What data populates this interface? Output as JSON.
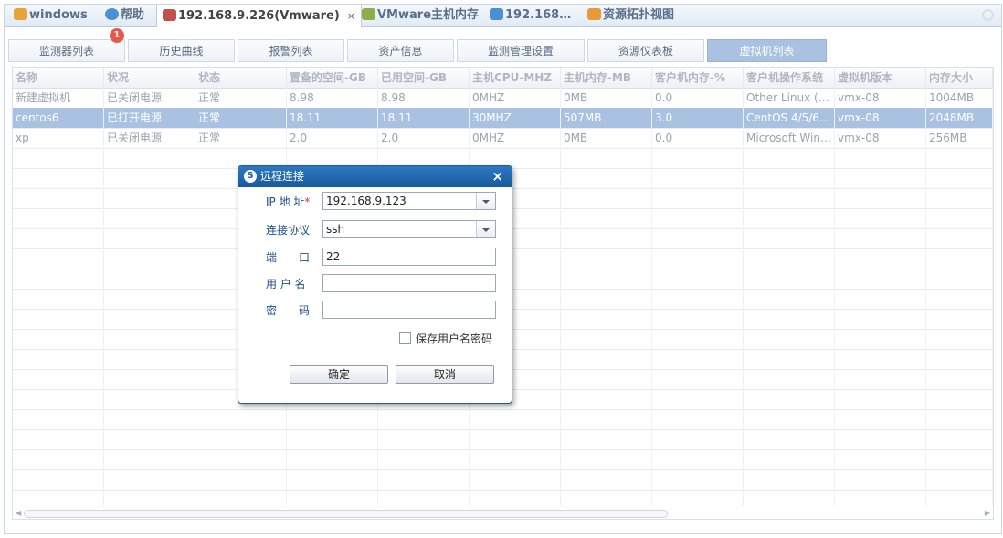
{
  "top_tabs": [
    {
      "label": "windows",
      "icon": "windows-folder-icon",
      "color": "#e8a23a"
    },
    {
      "label": "帮助",
      "icon": "help-icon",
      "color": "#4b8fd6"
    },
    {
      "label": "192.168.9.226(Vmware)",
      "icon": "vmware-host-icon",
      "close": "×",
      "color": "#c0504d"
    },
    {
      "label": "VMware主机内存",
      "icon": "memory-icon",
      "color": "#8fae4a"
    },
    {
      "label": "192.168…",
      "icon": "network-icon",
      "color": "#4b8fd6"
    },
    {
      "label": "资源拓扑视图",
      "icon": "topology-icon",
      "color": "#e89a3a"
    }
  ],
  "sub_tabs": [
    "监测器列表",
    "历史曲线",
    "报警列表",
    "资产信息",
    "监测管理设置",
    "资源仪表板",
    "虚拟机列表"
  ],
  "badge_count": "1",
  "table": {
    "columns": [
      "名称",
      "状况",
      "状态",
      "置备的空间-GB",
      "已用空间-GB",
      "主机CPU-MHZ",
      "主机内存-MB",
      "客户机内存-%",
      "客户机操作系统",
      "虚拟机版本",
      "内存大小"
    ],
    "rows": [
      [
        "新建虚拟机",
        "已关闭电源",
        "正常",
        "8.98",
        "8.98",
        "0MHZ",
        "0MB",
        "0.0",
        "Other Linux (…",
        "vmx-08",
        "1004MB"
      ],
      [
        "centos6",
        "已打开电源",
        "正常",
        "18.11",
        "18.11",
        "30MHZ",
        "507MB",
        "3.0",
        "CentOS 4/5/6…",
        "vmx-08",
        "2048MB"
      ],
      [
        "xp",
        "已关闭电源",
        "正常",
        "2.0",
        "2.0",
        "0MHZ",
        "0MB",
        "0.0",
        "Microsoft Win…",
        "vmx-08",
        "256MB"
      ]
    ],
    "selected_row": 1
  },
  "dialog": {
    "title": "远程连接",
    "close": "×",
    "ip_label": "IP 地 址",
    "required_mark": "*",
    "ip_value": "192.168.9.123",
    "protocol_label": "连接协议",
    "protocol_value": "ssh",
    "port_label": "端　　口",
    "port_value": "22",
    "user_label": "用 户 名",
    "user_value": "",
    "password_label": "密　　码",
    "password_value": "",
    "save_label": "保存用户名密码",
    "save_checked": false,
    "ok_label": "确定",
    "cancel_label": "取消"
  }
}
